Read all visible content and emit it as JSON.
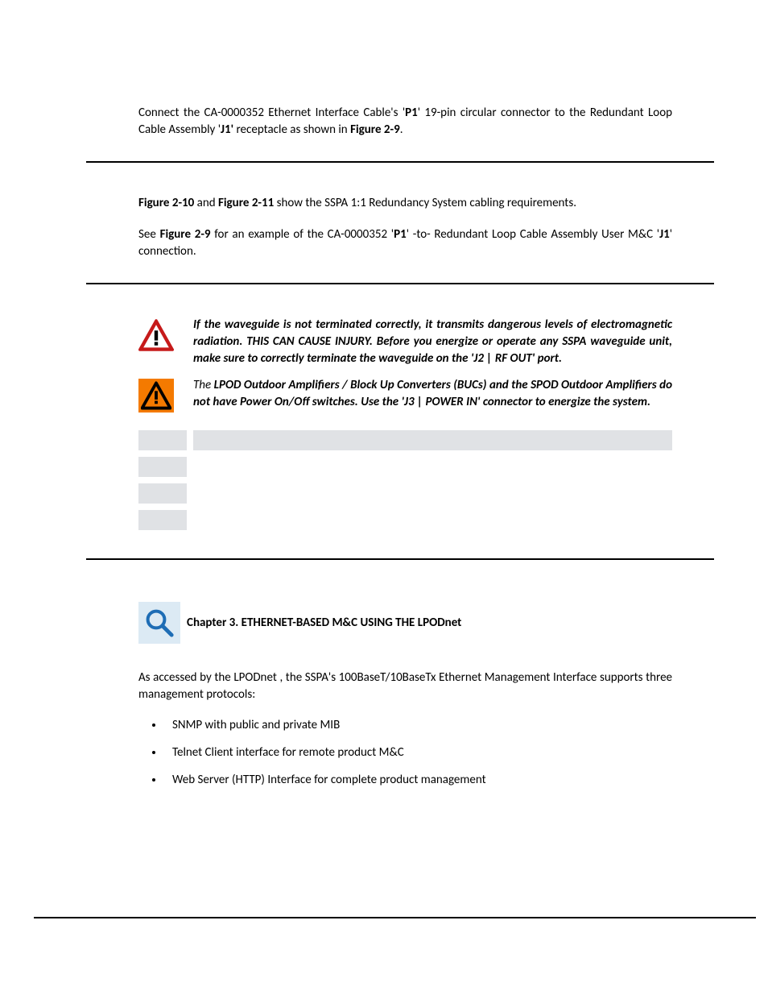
{
  "para1": {
    "t1": "Connect the CA-0000352 Ethernet Interface Cable's '",
    "p1": "P1",
    "t2": "' 19-pin circular connector to the Redundant Loop Cable Assembly '",
    "j1": "J1'",
    "t3": " receptacle as shown in ",
    "fig29": "Figure 2-9",
    "t4": "."
  },
  "para2": {
    "fig210": "Figure 2-10",
    "t1": " and ",
    "fig211": "Figure 2-11",
    "t2": " show the SSPA 1:1 Redundancy System cabling requirements."
  },
  "para3": {
    "t1": "See ",
    "fig29": "Figure 2-9",
    "t2": " for an example of the CA-0000352 '",
    "p1": "P1",
    "t3": "' -to- Redundant Loop Cable Assembly User M&C '",
    "j1": "J1",
    "t4": "' connection."
  },
  "danger": "If the waveguide is not terminated correctly, it transmits dangerous levels of electromagnetic radiation. THIS CAN CAUSE INJURY.  Before you energize or operate any SSPA waveguide unit, make sure to correctly terminate the waveguide on the 'J2 |  RF OUT' port.",
  "caution": {
    "t1": "The ",
    "lpod": "LPOD",
    "t2": " Outdoor Amplifiers / Block Up Converters (BUCs) and the SPOD Outdoor Amplifiers do not have Power On/Off switches. Use the 'J3 | POWER IN' connector to energize the system."
  },
  "chapter_title": "Chapter 3. ETHERNET-BASED M&C USING THE LPODnet",
  "para4": "As accessed by the LPODnet , the SSPA's 100BaseT/10BaseTx Ethernet Management Interface supports three management protocols:",
  "bullets": [
    "SNMP with public and private MIB",
    "Telnet Client interface for remote product M&C",
    "Web Server (HTTP) Interface for complete product management"
  ],
  "icons": {
    "danger": "danger-triangle-red",
    "caution": "caution-triangle-orange",
    "magnify": "magnifying-glass"
  }
}
